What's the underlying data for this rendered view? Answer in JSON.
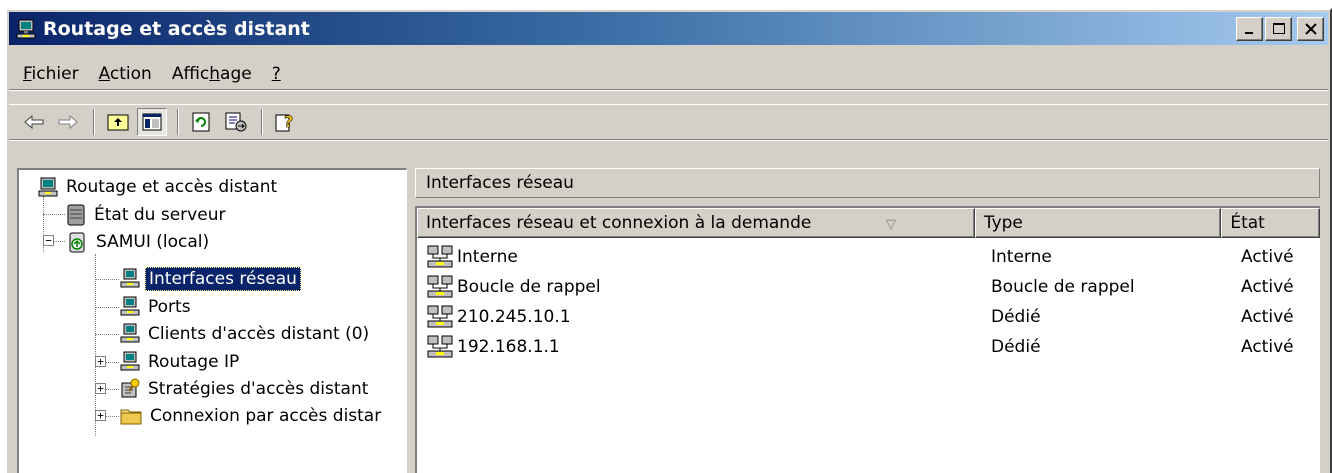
{
  "window": {
    "title": "Routage et accès distant",
    "minimize_label": "_",
    "maximize_label": "□",
    "close_label": "×"
  },
  "menu": [
    {
      "label": "Fichier",
      "accel": "F",
      "rest": "ichier"
    },
    {
      "label": "Action",
      "accel": "A",
      "rest": "ction"
    },
    {
      "label": "Affichage",
      "pre": "Affic",
      "accel": "h",
      "post": "age"
    },
    {
      "label": "?",
      "accel": "?",
      "rest": ""
    }
  ],
  "toolbar": {
    "icons": [
      "back-arrow-icon",
      "forward-arrow-icon",
      "up-folder-icon",
      "show-hide-tree-icon",
      "refresh-icon",
      "export-list-icon",
      "help-icon"
    ]
  },
  "tree": {
    "root": "Routage et accès distant",
    "server_status": "État du serveur",
    "server": "SAMUI (local)",
    "network_interfaces": "Interfaces réseau",
    "ports": "Ports",
    "remote_clients": "Clients d'accès distant (0)",
    "ip_routing": "Routage IP",
    "remote_policies": "Stratégies d'accès distant",
    "remote_connection": "Connexion par accès distar"
  },
  "details": {
    "pane_title": "Interfaces réseau",
    "columns": [
      "Interfaces réseau et connexion à la demande",
      "Type",
      "État"
    ],
    "sort_indicator": "▽",
    "rows": [
      {
        "name": "Interne",
        "type": "Interne",
        "state": "Activé"
      },
      {
        "name": "Boucle de rappel",
        "type": "Boucle de rappel",
        "state": "Activé"
      },
      {
        "name": "210.245.10.1",
        "type": "Dédié",
        "state": "Activé"
      },
      {
        "name": "192.168.1.1",
        "type": "Dédié",
        "state": "Activé"
      }
    ]
  },
  "colors": {
    "titlebar_start": "#0a246a",
    "titlebar_end": "#a6caf0",
    "selection": "#0a246a",
    "chrome": "#d4d0c8"
  }
}
